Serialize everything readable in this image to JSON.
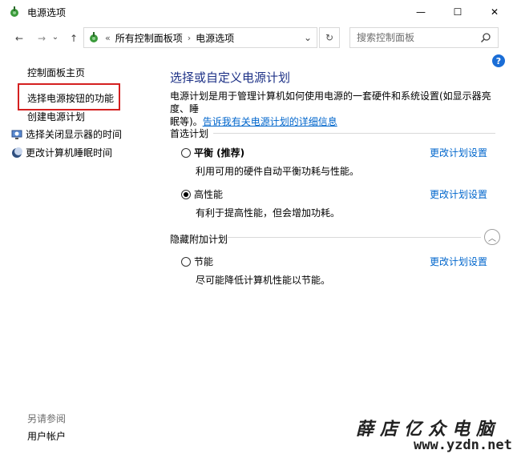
{
  "window": {
    "title": "电源选项",
    "minimize_glyph": "—",
    "maximize_glyph": "☐",
    "close_glyph": "✕"
  },
  "nav": {
    "back_glyph": "←",
    "forward_glyph": "→",
    "recent_glyph": "⌄",
    "up_glyph": "↑"
  },
  "address": {
    "chevron": "«",
    "crumbs": [
      "所有控制面板项",
      "电源选项"
    ],
    "separator": "›",
    "dropdown_glyph": "⌄",
    "refresh_glyph": "↻"
  },
  "search": {
    "placeholder": "搜索控制面板"
  },
  "sidebar": {
    "home": "控制面板主页",
    "items": [
      "选择电源按钮的功能",
      "创建电源计划",
      "选择关闭显示器的时间",
      "更改计算机睡眠时间"
    ],
    "see_also_label": "另请参阅",
    "user_accounts": "用户帐户"
  },
  "help_glyph": "?",
  "main": {
    "title": "选择或自定义电源计划",
    "description_1": "电源计划是用于管理计算机如何使用电源的一套硬件和系统设置(如显示器亮度、睡",
    "description_2": "眠等)。",
    "description_link": "告诉我有关电源计划的详细信息",
    "preferred_header": "首选计划",
    "hidden_header": "隐藏附加计划",
    "collapse_glyph": "︿",
    "plans": [
      {
        "name": "平衡 (推荐)",
        "desc": "利用可用的硬件自动平衡功耗与性能。",
        "selected": false,
        "bold": true
      },
      {
        "name": "高性能",
        "desc": "有利于提高性能，但会增加功耗。",
        "selected": true,
        "bold": false
      },
      {
        "name": "节能",
        "desc": "尽可能降低计算机性能以节能。",
        "selected": false,
        "bold": false
      }
    ],
    "change_settings": "更改计划设置"
  },
  "watermark": {
    "line1": "薛店亿众电脑",
    "line2": "www.yzdn.net"
  },
  "colors": {
    "accent_link": "#0066cc",
    "title_blue": "#1e3287",
    "highlight_box": "#d42020"
  }
}
